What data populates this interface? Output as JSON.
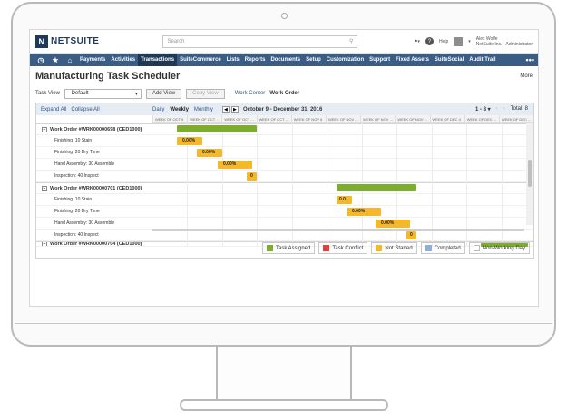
{
  "brand": {
    "name": "NETSUITE",
    "mark": "N"
  },
  "search": {
    "placeholder": "Search"
  },
  "user": {
    "name": "Alex Wolfe",
    "company": "NetSuite Inc. - Administrator"
  },
  "help_label": "Help",
  "nav": {
    "items": [
      "Payments",
      "Activities",
      "Transactions",
      "SuiteCommerce",
      "Lists",
      "Reports",
      "Documents",
      "Setup",
      "Customization",
      "Support",
      "Fixed Assets",
      "SuiteSocial",
      "Audit Trail"
    ],
    "active": "Transactions",
    "more": "•••"
  },
  "page": {
    "title": "Manufacturing Task Scheduler",
    "more": "More"
  },
  "toolbar": {
    "task_view_label": "Task View",
    "task_view_value": "- Default -",
    "add_view": "Add View",
    "copy_view": "Copy View",
    "work_center": "Work Center",
    "work_order": "Work Order"
  },
  "schedule": {
    "expand_all": "Expand All",
    "collapse_all": "Collapse All",
    "modes": [
      "Daily",
      "Weekly",
      "Monthly"
    ],
    "selected_mode": "Weekly",
    "date_range": "October 9 - December 31, 2016",
    "pager": "1 - 8 ▾",
    "total": "Total: 8",
    "weeks": [
      "WEEK OF OCT 9",
      "WEEK OF OCT ...",
      "WEEK OF OCT ...",
      "WEEK OF OCT ...",
      "WEEK OF NOV 6",
      "WEEK OF NOV ...",
      "WEEK OF NOV ...",
      "WEEK OF NOV ...",
      "WEEK OF DEC 4",
      "WEEK OF DEC ...",
      "WEEK OF DEC ..."
    ],
    "work_orders": [
      {
        "title": "Work Order #WRK00000698 (CED1000)",
        "tasks": [
          {
            "label": "Finishing: 10 Stain",
            "progress": "0.00%"
          },
          {
            "label": "Finishing: 20 Dry Time",
            "progress": "0.00%"
          },
          {
            "label": "Hand Assembly: 30 Assemble",
            "progress": "0.00%"
          },
          {
            "label": "Inspection: 40 Inspect",
            "progress": "0"
          }
        ]
      },
      {
        "title": "Work Order #WRK00000701 (CED1000)",
        "tasks": [
          {
            "label": "Finishing: 10 Stain",
            "progress": "0.0"
          },
          {
            "label": "Finishing: 20 Dry Time",
            "progress": "0.00%"
          },
          {
            "label": "Hand Assembly: 30 Assemble",
            "progress": "0.00%"
          },
          {
            "label": "Inspection: 40 Inspect",
            "progress": "0"
          }
        ]
      },
      {
        "title": "Work Order #WRK00000704 (CED1000)"
      }
    ]
  },
  "legend": [
    {
      "label": "Task Assigned",
      "color": "#7dad2f"
    },
    {
      "label": "Task Conflict",
      "color": "#e0413a"
    },
    {
      "label": "Not Started",
      "color": "#f6b82b"
    },
    {
      "label": "Completed",
      "color": "#8eaede"
    },
    {
      "label": "Non-Working Day",
      "color": "#ffffff"
    }
  ]
}
